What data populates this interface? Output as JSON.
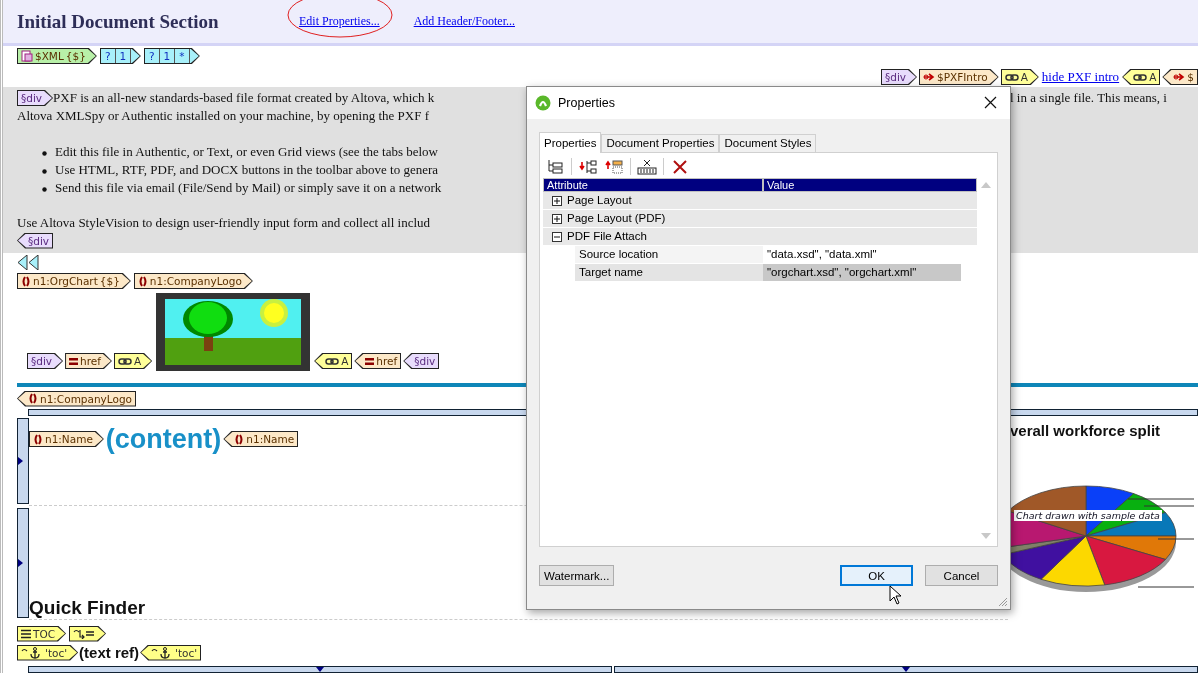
{
  "header": {
    "title": "Initial Document Section",
    "links": [
      {
        "label": "Edit Properties...",
        "circled": true
      },
      {
        "label": "Add Header/Footer...",
        "circled": false
      }
    ]
  },
  "top_tags": [
    {
      "kind": "xml",
      "closing": false,
      "label": "$XML",
      "suffix": "{$}"
    },
    {
      "kind": "cond",
      "closing": false,
      "cells": [
        "?",
        "1"
      ]
    },
    {
      "kind": "cond",
      "closing": false,
      "cells": [
        "?",
        "1",
        "*"
      ]
    }
  ],
  "intro_bar": [
    {
      "kind": "div",
      "closing": false,
      "label": "§div"
    },
    {
      "kind": "param",
      "closing": false,
      "label": "$PXFIntro"
    },
    {
      "kind": "link",
      "closing": false,
      "label": "A"
    },
    {
      "kind": "text_link",
      "label": "hide PXF intro"
    },
    {
      "kind": "link",
      "closing": true,
      "label": "A"
    },
    {
      "kind": "param",
      "closing": true,
      "label": "$"
    }
  ],
  "intro": {
    "start_tag": {
      "kind": "div",
      "closing": false,
      "label": "§div"
    },
    "lines": [
      {
        "left": "PXF is an all-new standards-based file format created by Altova, which k",
        "right": "l in a single file. This means, i"
      },
      {
        "left": "Altova XMLSpy or Authentic installed on your machine, by opening the PXF f"
      }
    ],
    "bullets": [
      "Edit this file in Authentic, or Text, or even Grid views (see the tabs below",
      "Use HTML, RTF, PDF, and DOCX buttons in the toolbar above to genera",
      "Send this file via email (File/Send by Mail) or simply save it on a network"
    ],
    "closing": "Use Altova StyleVision to design user-friendly input form and collect all includ",
    "end_tag": {
      "kind": "div",
      "closing": true,
      "label": "§div"
    }
  },
  "org_tags": [
    {
      "kind": "element",
      "closing": false,
      "label": "n1:OrgChart",
      "suffix": "{$}"
    },
    {
      "kind": "element",
      "closing": false,
      "label": "n1:CompanyLogo"
    }
  ],
  "logo_row": {
    "before": [
      {
        "kind": "div",
        "closing": false,
        "label": "§div"
      },
      {
        "kind": "attr",
        "closing": false,
        "label": "href"
      },
      {
        "kind": "link",
        "closing": false,
        "label": "A"
      }
    ],
    "after": [
      {
        "kind": "link",
        "closing": true,
        "label": "A"
      },
      {
        "kind": "attr",
        "closing": true,
        "label": "href"
      },
      {
        "kind": "div",
        "closing": true,
        "label": "§div"
      }
    ]
  },
  "logo_end_tag": {
    "kind": "element",
    "closing": true,
    "label": "n1:CompanyLogo"
  },
  "name_row": {
    "before": {
      "kind": "element",
      "closing": false,
      "label": "n1:Name"
    },
    "content": "(content)",
    "after": {
      "kind": "element",
      "closing": true,
      "label": "n1:Name"
    }
  },
  "chart": {
    "title": "verall workforce split",
    "note": "Chart drawn with sample data"
  },
  "quick_finder": "Quick Finder",
  "toc_tags": [
    {
      "kind": "toc",
      "closing": false,
      "label": "TOC"
    },
    {
      "kind": "tocref",
      "closing": false
    }
  ],
  "anchor_row": {
    "before": {
      "kind": "anchor",
      "closing": false,
      "label": "'toc'"
    },
    "text": "(text ref)",
    "after": {
      "kind": "anchor",
      "closing": true,
      "label": "'toc'"
    }
  },
  "dialog": {
    "title": "Properties",
    "tabs": [
      {
        "label": "Properties",
        "selected": true
      },
      {
        "label": "Document Properties",
        "selected": false
      },
      {
        "label": "Document Styles",
        "selected": false
      }
    ],
    "columns": [
      "Attribute",
      "Value"
    ],
    "groups": [
      {
        "label": "Page Layout",
        "expanded": false
      },
      {
        "label": "Page Layout (PDF)",
        "expanded": false
      },
      {
        "label": "PDF File Attach",
        "expanded": true,
        "children": [
          {
            "label": "Source location",
            "value": "\"data.xsd\", \"data.xml\"",
            "selected": false
          },
          {
            "label": "Target name",
            "value": "\"orgchart.xsd\", \"orgchart.xml\"",
            "selected": true
          }
        ]
      }
    ],
    "buttons": [
      {
        "label": "Watermark...",
        "kind": "side"
      },
      {
        "label": "OK",
        "kind": "default"
      },
      {
        "label": "Cancel",
        "kind": "normal"
      }
    ]
  }
}
